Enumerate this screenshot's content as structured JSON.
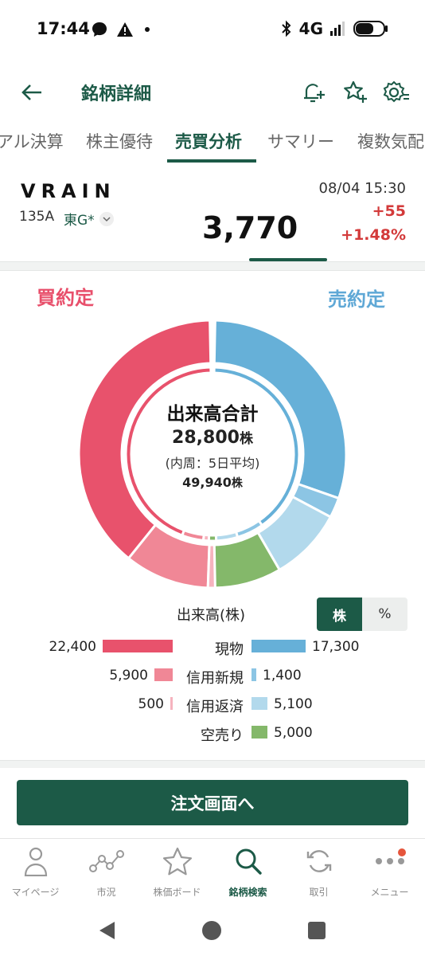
{
  "status_bar": {
    "time": "17:44",
    "network": "4G",
    "icons": [
      "chat-bubble-icon",
      "warning-icon",
      "dot-icon",
      "bluetooth-icon",
      "signal-icon",
      "battery-icon"
    ]
  },
  "header": {
    "title": "銘柄詳細",
    "back_icon": "arrow-left-icon",
    "actions": [
      "bell-plus-icon",
      "star-plus-icon",
      "settings-icon"
    ]
  },
  "tabs": [
    "アル決算",
    "株主優待",
    "売買分析",
    "サマリー",
    "複数気配"
  ],
  "active_tab": "売買分析",
  "stock": {
    "name": "VRAIN",
    "code": "135A",
    "market": "東G*",
    "price": "3,770",
    "timestamp": "08/04 15:30",
    "change": "+55",
    "change_pct": "+1.48%"
  },
  "analysis": {
    "buy_label": "買約定",
    "sell_label": "売約定",
    "center_title": "出来高合計",
    "total_volume": "28,800",
    "unit": "株",
    "inner_note": "(内周：5日平均)",
    "avg_volume": "49,940",
    "legend_title": "出来高(株)",
    "toggle": [
      "株",
      "%"
    ],
    "toggle_active": "株",
    "colors": {
      "buy_spot": "#e8526c",
      "buy_margin_new": "#f08796",
      "buy_margin_repay": "#f6b3be",
      "sell_spot": "#66b0d8",
      "sell_margin_new": "#8cc5e4",
      "sell_margin_repay": "#b2d9ec",
      "short": "#84b86a"
    }
  },
  "chart_data": {
    "type": "donut",
    "outer": {
      "buy": [
        {
          "name": "現物",
          "value": 22400
        },
        {
          "name": "信用新規",
          "value": 5900
        },
        {
          "name": "信用返済",
          "value": 500
        }
      ],
      "sell": [
        {
          "name": "現物",
          "value": 17300
        },
        {
          "name": "信用新規",
          "value": 1400
        },
        {
          "name": "信用返済",
          "value": 5100
        },
        {
          "name": "空売り",
          "value": 5000
        }
      ]
    },
    "inner_5day_avg_fraction": {
      "buy": [
        0.44,
        0.04,
        0.01
      ],
      "sell": [
        0.4,
        0.05,
        0.04,
        0.05
      ]
    }
  },
  "legend_rows": [
    {
      "name": "現物",
      "buy": "22,400",
      "sell": "17,300",
      "buy_v": 22400,
      "sell_v": 17300
    },
    {
      "name": "信用新規",
      "buy": "5,900",
      "sell": "1,400",
      "buy_v": 5900,
      "sell_v": 1400
    },
    {
      "name": "信用返済",
      "buy": "500",
      "sell": "5,100",
      "buy_v": 500,
      "sell_v": 5100
    },
    {
      "name": "空売り",
      "buy": "",
      "sell": "5,000",
      "buy_v": 0,
      "sell_v": 5000
    }
  ],
  "order_button": "注文画面へ",
  "bottom_nav": [
    {
      "label": "マイページ",
      "icon": "person-icon"
    },
    {
      "label": "市況",
      "icon": "market-trend-icon"
    },
    {
      "label": "株価ボード",
      "icon": "star-icon"
    },
    {
      "label": "銘柄検索",
      "icon": "search-icon"
    },
    {
      "label": "取引",
      "icon": "refresh-icon"
    },
    {
      "label": "メニュー",
      "icon": "more-dots-icon"
    }
  ],
  "active_nav": "銘柄検索"
}
